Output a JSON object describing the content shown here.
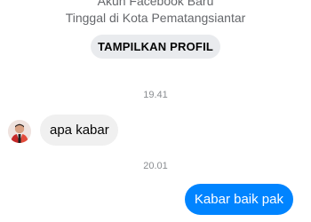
{
  "profile": {
    "subtitle": "Akun Facebook Baru",
    "location": "Tinggal di Kota Pematangsiantar",
    "view_profile_label": "TAMPILKAN PROFIL"
  },
  "messages": [
    {
      "timestamp": "19.41",
      "sender": "contact",
      "text": "apa kabar"
    },
    {
      "timestamp": "20.01",
      "sender": "me",
      "text": "Kabar baik pak"
    }
  ],
  "colors": {
    "outgoing_bubble": "#0084ff",
    "incoming_bubble": "#f0f0f0",
    "secondary_text": "#65676b",
    "button_bg": "#e9ebee"
  },
  "icons": {
    "avatar": "contact-avatar"
  }
}
